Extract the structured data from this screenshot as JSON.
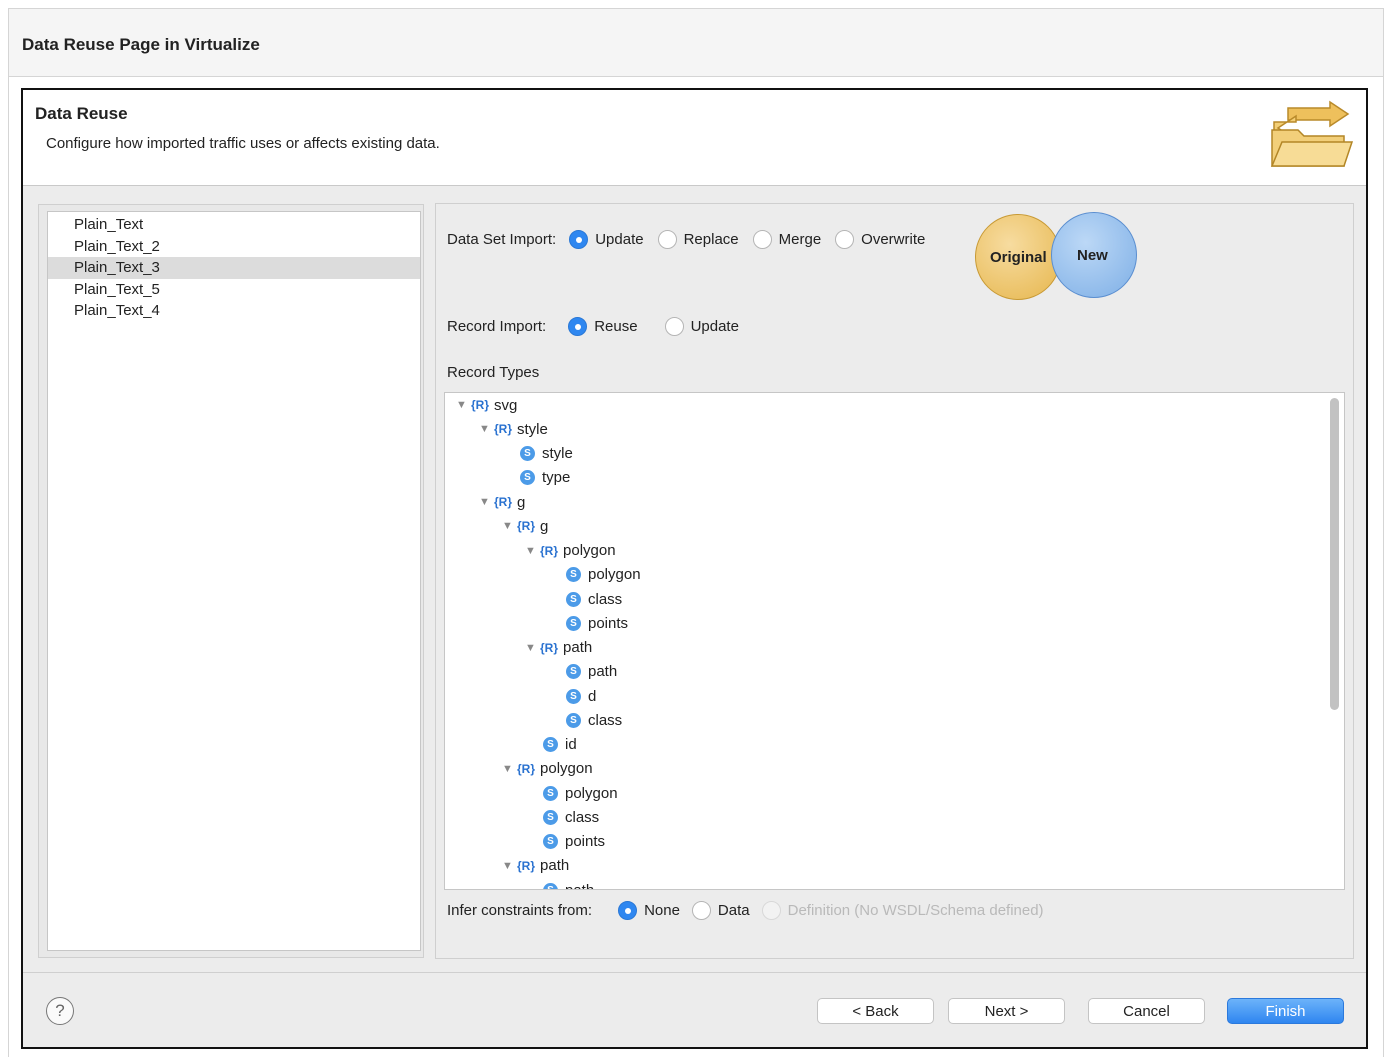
{
  "page": {
    "title": "Data Reuse Page in Virtualize"
  },
  "dialog": {
    "title": "Data Reuse",
    "description": "Configure how imported traffic uses or affects existing data.",
    "icon": "folder-exchange-icon"
  },
  "list": {
    "items": [
      {
        "label": "Plain_Text",
        "selected": false
      },
      {
        "label": "Plain_Text_2",
        "selected": false
      },
      {
        "label": "Plain_Text_3",
        "selected": true
      },
      {
        "label": "Plain_Text_5",
        "selected": false
      },
      {
        "label": "Plain_Text_4",
        "selected": false
      }
    ]
  },
  "data_set_import": {
    "label": "Data Set Import:",
    "options": [
      "Update",
      "Replace",
      "Merge",
      "Overwrite"
    ],
    "selected": "Update"
  },
  "venn": {
    "original": "Original",
    "new": "New"
  },
  "record_import": {
    "label": "Record Import:",
    "options": [
      "Reuse",
      "Update"
    ],
    "selected": "Reuse"
  },
  "record_types": {
    "label": "Record Types",
    "badges": {
      "record": "{R}",
      "string": "S"
    },
    "nodes": [
      {
        "type": "R",
        "label": "svg",
        "depth": 0
      },
      {
        "type": "R",
        "label": "style",
        "depth": 1
      },
      {
        "type": "S",
        "label": "style",
        "depth": 2
      },
      {
        "type": "S",
        "label": "type",
        "depth": 2
      },
      {
        "type": "R",
        "label": "g",
        "depth": 1
      },
      {
        "type": "R",
        "label": "g",
        "depth": 2
      },
      {
        "type": "R",
        "label": "polygon",
        "depth": 3
      },
      {
        "type": "S",
        "label": "polygon",
        "depth": 4
      },
      {
        "type": "S",
        "label": "class",
        "depth": 4
      },
      {
        "type": "S",
        "label": "points",
        "depth": 4
      },
      {
        "type": "R",
        "label": "path",
        "depth": 3
      },
      {
        "type": "S",
        "label": "path",
        "depth": 4
      },
      {
        "type": "S",
        "label": "d",
        "depth": 4
      },
      {
        "type": "S",
        "label": "class",
        "depth": 4
      },
      {
        "type": "S",
        "label": "id",
        "depth": 3
      },
      {
        "type": "R",
        "label": "polygon",
        "depth": 2
      },
      {
        "type": "S",
        "label": "polygon",
        "depth": 3
      },
      {
        "type": "S",
        "label": "class",
        "depth": 3
      },
      {
        "type": "S",
        "label": "points",
        "depth": 3
      },
      {
        "type": "R",
        "label": "path",
        "depth": 2
      },
      {
        "type": "S",
        "label": "path",
        "depth": 3
      }
    ]
  },
  "infer_constraints": {
    "label": "Infer constraints from:",
    "options": [
      {
        "label": "None",
        "checked": true,
        "disabled": false
      },
      {
        "label": "Data",
        "checked": false,
        "disabled": false
      },
      {
        "label": "Definition (No WSDL/Schema defined)",
        "checked": false,
        "disabled": true
      }
    ]
  },
  "footer": {
    "help": "?",
    "back": "< Back",
    "next": "Next >",
    "cancel": "Cancel",
    "finish": "Finish"
  },
  "colors": {
    "accent": "#2f87f0",
    "original_circle": "#e9bd5a",
    "new_circle": "#8cb8ea"
  }
}
